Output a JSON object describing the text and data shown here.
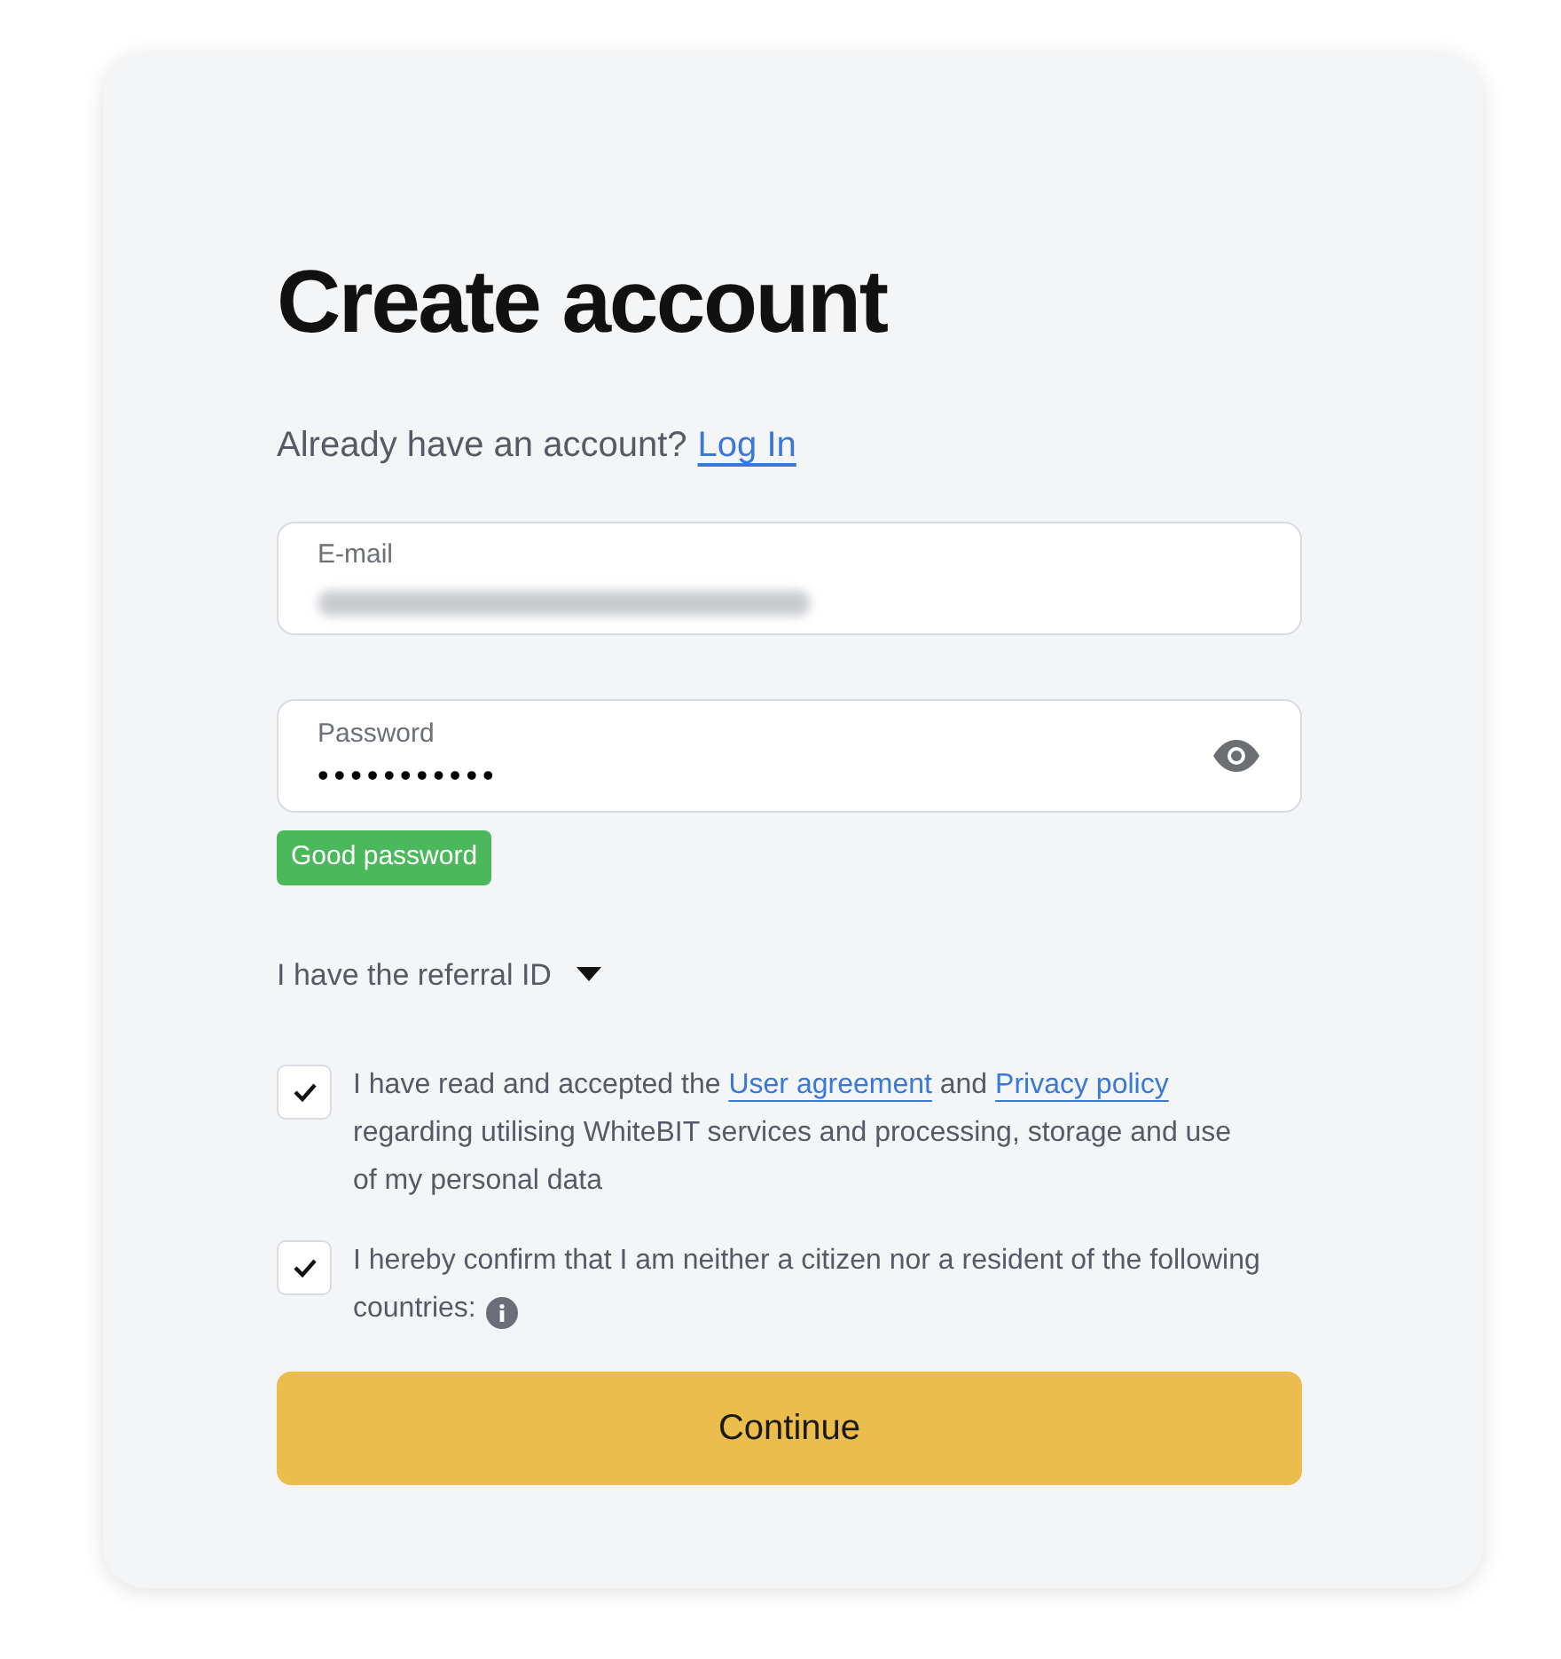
{
  "title": "Create account",
  "login_prompt": {
    "text": "Already have an account?",
    "link": "Log In"
  },
  "email_field": {
    "label": "E-mail",
    "value_blurred": true
  },
  "password_field": {
    "label": "Password",
    "value": "•••••••••••"
  },
  "password_strength": {
    "text": "Good password",
    "color": "#4cb85c"
  },
  "referral": {
    "label": "I have the referral ID",
    "expanded": false
  },
  "agreements": [
    {
      "checked": true,
      "parts": [
        {
          "kind": "text",
          "text": "I have read and accepted the "
        },
        {
          "kind": "link",
          "text": "User agreement"
        },
        {
          "kind": "text",
          "text": " and "
        },
        {
          "kind": "link",
          "text": "Privacy policy"
        },
        {
          "kind": "text",
          "text": " regarding utilising WhiteBIT services and processing, storage and use of my personal data"
        }
      ],
      "info": false
    },
    {
      "checked": true,
      "parts": [
        {
          "kind": "text",
          "text": "I hereby confirm that I am neither a citizen nor a resident of the following countries:"
        }
      ],
      "info": true
    }
  ],
  "submit_button": "Continue"
}
